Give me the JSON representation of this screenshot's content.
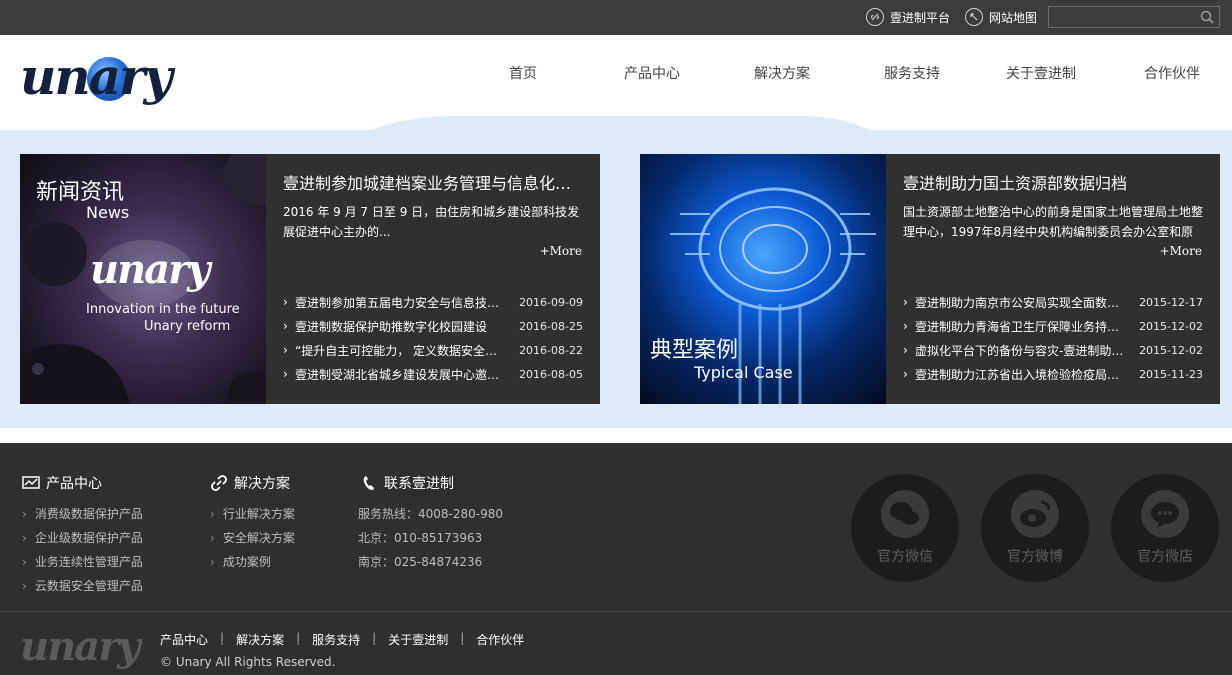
{
  "topbar": {
    "platform": "壹进制平台",
    "sitemap": "网站地图",
    "search_placeholder": ""
  },
  "logo": {
    "text": "unary"
  },
  "nav": [
    "首页",
    "产品中心",
    "解决方案",
    "服务支持",
    "关于壹进制",
    "合作伙伴"
  ],
  "news": {
    "img_cn": "新闻资讯",
    "img_en": "News",
    "img_logo": "unary",
    "img_slogan1": "Innovation in the future",
    "img_slogan2": "Unary reform",
    "title": "壹进制参加城建档案业务管理与信息化建设",
    "desc": "2016 年 9 月 7 日至 9 日，由住房和城乡建设部科技发展促进中心主办的...",
    "more": "+More",
    "items": [
      {
        "text": "壹进制参加第五届电力安全与信息技术论坛",
        "date": "2016-09-09"
      },
      {
        "text": "壹进制数据保护助推数字化校园建设",
        "date": "2016-08-25"
      },
      {
        "text": "“提升自主可控能力， 定义数据安全新标准”",
        "date": "2016-08-22"
      },
      {
        "text": "壹进制受湖北省城乡建设发展中心邀请参加",
        "date": "2016-08-05"
      }
    ]
  },
  "cases": {
    "img_cn": "典型案例",
    "img_en": "Typical Case",
    "title": "壹进制助力国土资源部数据归档",
    "desc": "国土资源部土地整治中心的前身是国家土地管理局土地整理中心，1997年8月经中央机构编制委员会办公室和原",
    "more": "+More",
    "items": [
      {
        "text": "壹进制助力南京市公安局实现全面数据保护",
        "date": "2015-12-17"
      },
      {
        "text": "壹进制助力青海省卫生厅保障业务持续运行",
        "date": "2015-12-02"
      },
      {
        "text": "虚拟化平台下的备份与容灾-壹进制助力客户",
        "date": "2015-12-02"
      },
      {
        "text": "壹进制助力江苏省出入境检验检疫局数据保护",
        "date": "2015-11-23"
      }
    ]
  },
  "footer": {
    "products": {
      "title": "产品中心",
      "items": [
        "消费级数据保护产品",
        "企业级数据保护产品",
        "业务连续性管理产品",
        "云数据安全管理产品"
      ]
    },
    "solutions": {
      "title": "解决方案",
      "items": [
        "行业解决方案",
        "安全解决方案",
        "成功案例"
      ]
    },
    "contact": {
      "title": "联系壹进制",
      "items": [
        "服务热线：4008-280-980",
        "北京：010-85173963",
        "南京：025-84874236"
      ]
    },
    "social": [
      "官方微信",
      "官方微博",
      "官方微店"
    ],
    "logo": "unary",
    "links": [
      "产品中心",
      "解决方案",
      "服务支持",
      "关于壹进制",
      "合作伙伴"
    ],
    "copyright": "© Unary All Rights Reserved."
  }
}
